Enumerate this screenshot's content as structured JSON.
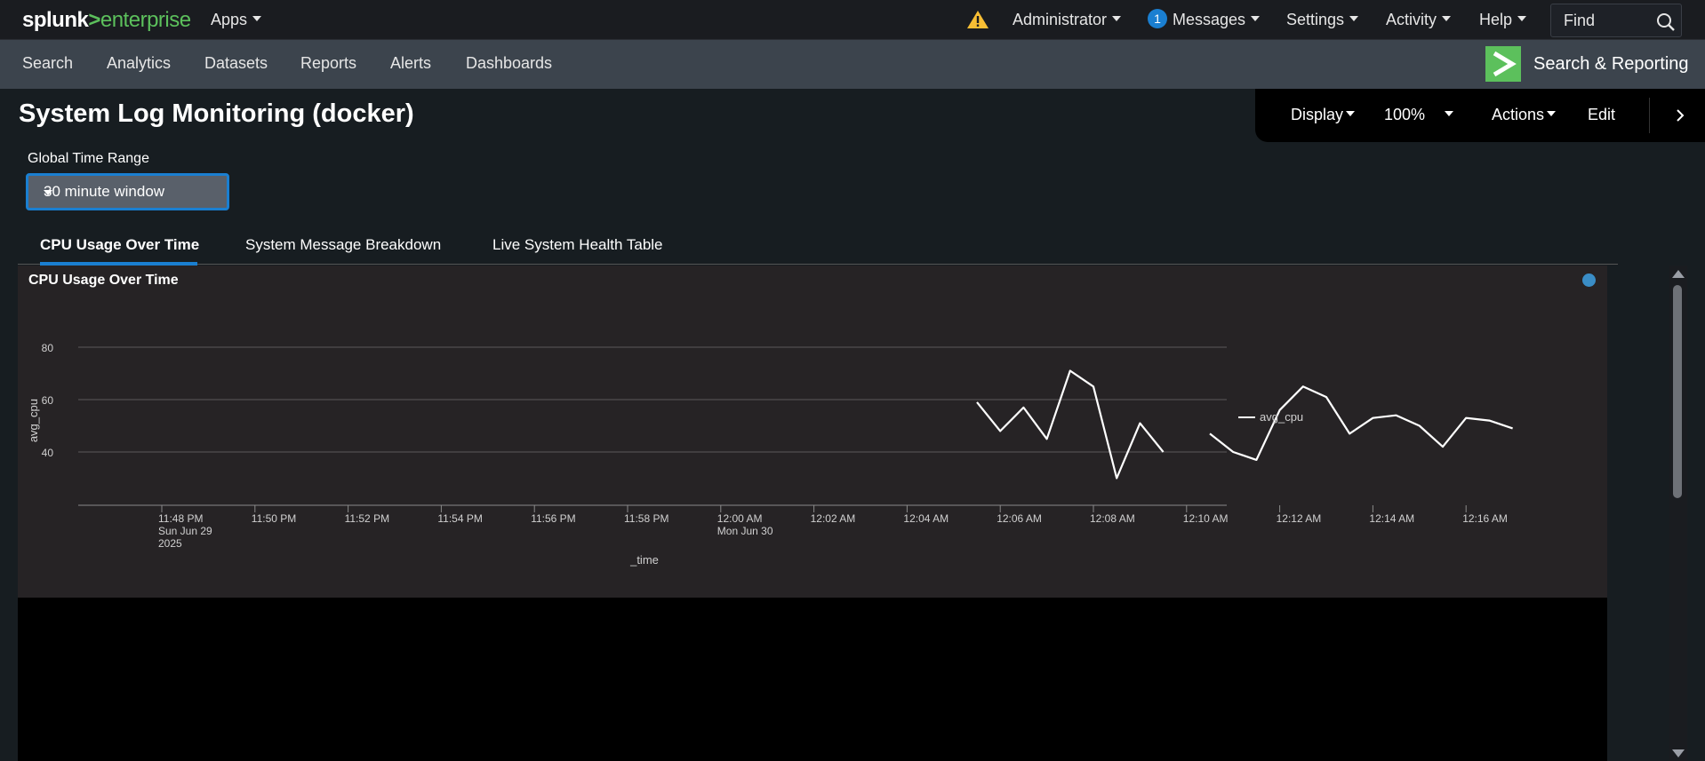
{
  "topbar": {
    "logo": {
      "splunk": "splunk",
      "gt": ">",
      "enterprise": "enterprise"
    },
    "apps_label": "Apps",
    "admin_label": "Administrator",
    "messages_count": "1",
    "messages_label": "Messages",
    "settings_label": "Settings",
    "activity_label": "Activity",
    "help_label": "Help",
    "find_placeholder": "Find"
  },
  "appbar": {
    "items": [
      "Search",
      "Analytics",
      "Datasets",
      "Reports",
      "Alerts",
      "Dashboards"
    ],
    "app_name": "Search & Reporting"
  },
  "dashboard": {
    "title": "System Log Monitoring (docker)",
    "tools": {
      "display": "Display",
      "zoom": "100%",
      "actions": "Actions",
      "edit": "Edit"
    },
    "time_range": {
      "label": "Global Time Range",
      "value": "30 minute window"
    },
    "tabs": [
      "CPU Usage Over Time",
      "System Message Breakdown",
      "Live System Health Table"
    ],
    "active_tab": 0
  },
  "panel": {
    "title": "CPU Usage Over Time"
  },
  "colors": {
    "accent": "#1a7fd1",
    "brand_green": "#5cc05c",
    "warning": "#f8be34",
    "line": "#ffffff"
  },
  "chart_data": {
    "type": "line",
    "title": "CPU Usage Over Time",
    "xlabel": "_time",
    "ylabel": "avg_cpu",
    "ylim": [
      20,
      80
    ],
    "yticks": [
      40,
      60,
      80
    ],
    "grid": true,
    "legend_position": "right",
    "xticks": [
      {
        "minute": 0,
        "lines": [
          "11:48 PM",
          "Sun Jun 29",
          "2025"
        ]
      },
      {
        "minute": 2,
        "lines": [
          "11:50 PM"
        ]
      },
      {
        "minute": 4,
        "lines": [
          "11:52 PM"
        ]
      },
      {
        "minute": 6,
        "lines": [
          "11:54 PM"
        ]
      },
      {
        "minute": 8,
        "lines": [
          "11:56 PM"
        ]
      },
      {
        "minute": 10,
        "lines": [
          "11:58 PM"
        ]
      },
      {
        "minute": 12,
        "lines": [
          "12:00 AM",
          "Mon Jun 30"
        ]
      },
      {
        "minute": 14,
        "lines": [
          "12:02 AM"
        ]
      },
      {
        "minute": 16,
        "lines": [
          "12:04 AM"
        ]
      },
      {
        "minute": 18,
        "lines": [
          "12:06 AM"
        ]
      },
      {
        "minute": 20,
        "lines": [
          "12:08 AM"
        ]
      },
      {
        "minute": 22,
        "lines": [
          "12:10 AM"
        ]
      },
      {
        "minute": 24,
        "lines": [
          "12:12 AM"
        ]
      },
      {
        "minute": 26,
        "lines": [
          "12:14 AM"
        ]
      },
      {
        "minute": 28,
        "lines": [
          "12:16 AM"
        ]
      }
    ],
    "series": [
      {
        "name": "avg_cpu",
        "segments": [
          [
            [
              17.5,
              59
            ],
            [
              18.0,
              48
            ],
            [
              18.5,
              57
            ],
            [
              19.0,
              45
            ],
            [
              19.5,
              71
            ],
            [
              20.0,
              65
            ],
            [
              20.5,
              30
            ],
            [
              21.0,
              51
            ],
            [
              21.5,
              40
            ]
          ],
          [
            [
              22.5,
              47
            ],
            [
              23.0,
              40
            ],
            [
              23.5,
              37
            ],
            [
              24.0,
              56
            ],
            [
              24.5,
              65
            ],
            [
              25.0,
              61
            ],
            [
              25.5,
              47
            ],
            [
              26.0,
              53
            ],
            [
              26.5,
              54
            ],
            [
              27.0,
              50
            ],
            [
              27.5,
              42
            ],
            [
              28.0,
              53
            ],
            [
              28.5,
              52
            ],
            [
              29.0,
              49
            ]
          ]
        ]
      }
    ]
  }
}
